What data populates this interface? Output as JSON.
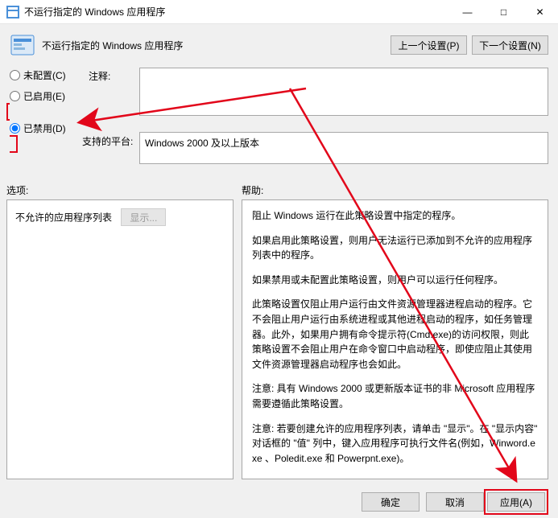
{
  "window": {
    "title": "不运行指定的 Windows 应用程序",
    "minimize": "—",
    "maximize": "□",
    "close": "✕"
  },
  "header": {
    "title": "不运行指定的 Windows 应用程序",
    "prev_btn": "上一个设置(P)",
    "next_btn": "下一个设置(N)"
  },
  "radios": {
    "not_configured": "未配置(C)",
    "enabled": "已启用(E)",
    "disabled": "已禁用(D)"
  },
  "comment": {
    "label": "注释:",
    "value": ""
  },
  "platform": {
    "label": "支持的平台:",
    "value": "Windows 2000 及以上版本"
  },
  "labels": {
    "options": "选项:",
    "help": "帮助:"
  },
  "options": {
    "list_label": "不允许的应用程序列表",
    "show_btn": "显示..."
  },
  "help": {
    "p1": "阻止 Windows 运行在此策略设置中指定的程序。",
    "p2": "如果启用此策略设置，则用户无法运行已添加到不允许的应用程序列表中的程序。",
    "p3": "如果禁用或未配置此策略设置，则用户可以运行任何程序。",
    "p4": "此策略设置仅阻止用户运行由文件资源管理器进程启动的程序。它不会阻止用户运行由系统进程或其他进程启动的程序，如任务管理器。此外，如果用户拥有命令提示符(Cmd.exe)的访问权限，则此策略设置不会阻止用户在命令窗口中启动程序，即使应阻止其使用文件资源管理器启动程序也会如此。",
    "p5": "注意: 具有 Windows 2000 或更新版本证书的非 Microsoft 应用程序需要遵循此策略设置。",
    "p6": "注意: 若要创建允许的应用程序列表，请单击 \"显示\"。在 \"显示内容\" 对话框的 \"值\" 列中，键入应用程序可执行文件名(例如，Winword.exe 、Poledit.exe 和 Powerpnt.exe)。"
  },
  "buttons": {
    "ok": "确定",
    "cancel": "取消",
    "apply": "应用(A)"
  }
}
